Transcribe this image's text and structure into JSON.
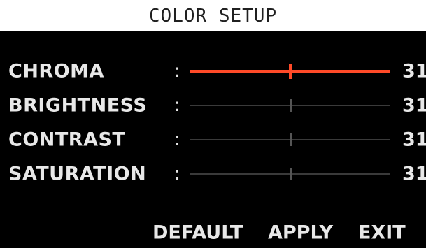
{
  "title": "COLOR SETUP",
  "settings": [
    {
      "label": "CHROMA",
      "separator": ":",
      "value": "31",
      "level": 0.5,
      "active": true
    },
    {
      "label": "BRIGHTNESS",
      "separator": ":",
      "value": "31",
      "level": 0.5,
      "active": false
    },
    {
      "label": "CONTRAST",
      "separator": ":",
      "value": "31",
      "level": 0.5,
      "active": false
    },
    {
      "label": "SATURATION",
      "separator": ":",
      "value": "31",
      "level": 0.5,
      "active": false
    }
  ],
  "buttons": {
    "default_label": "DEFAULT",
    "apply_label": "APPLY",
    "exit_label": "EXIT"
  },
  "colors": {
    "active_slider": "#ff4a28",
    "inactive_slider": "#3a3a3a",
    "panel_background": "#000000",
    "text": "#e8e8e8"
  }
}
